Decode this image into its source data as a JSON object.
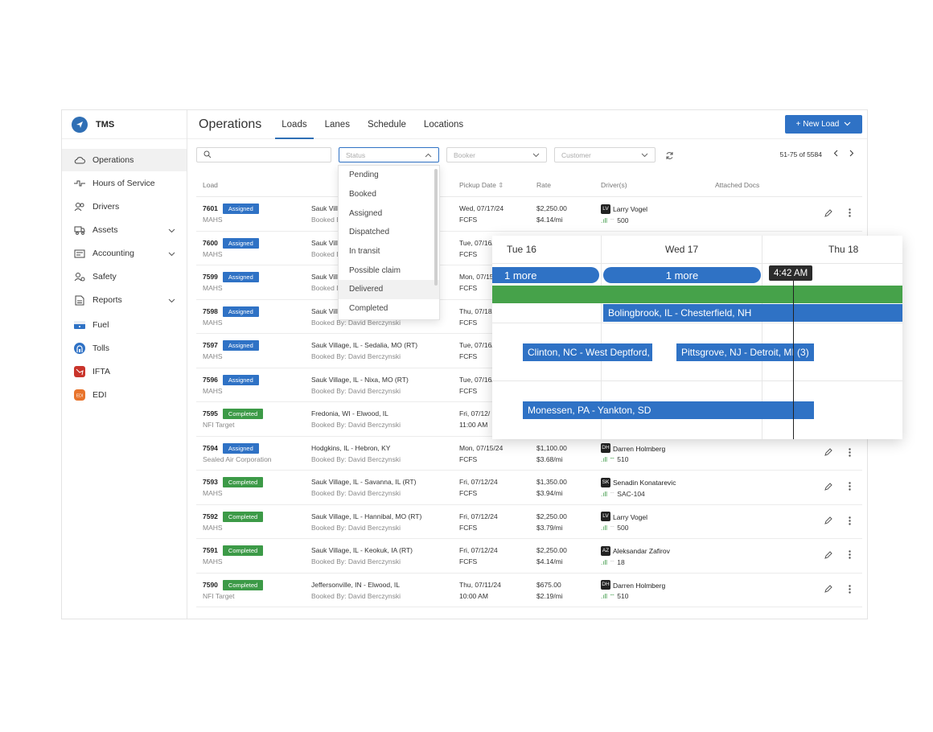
{
  "app": {
    "name": "TMS"
  },
  "sidebar": {
    "items": [
      {
        "label": "Operations",
        "icon": "cloud-icon",
        "active": true,
        "expandable": false
      },
      {
        "label": "Hours of Service",
        "icon": "pulse-icon",
        "active": false,
        "expandable": false
      },
      {
        "label": "Drivers",
        "icon": "users-icon",
        "active": false,
        "expandable": false
      },
      {
        "label": "Assets",
        "icon": "truck-icon",
        "active": false,
        "expandable": true
      },
      {
        "label": "Accounting",
        "icon": "ledger-icon",
        "active": false,
        "expandable": true
      },
      {
        "label": "Safety",
        "icon": "safety-icon",
        "active": false,
        "expandable": false
      },
      {
        "label": "Reports",
        "icon": "report-icon",
        "active": false,
        "expandable": true
      },
      {
        "label": "Fuel",
        "icon": "fuel-icon",
        "active": false,
        "expandable": false
      },
      {
        "label": "Tolls",
        "icon": "tolls-icon",
        "active": false,
        "expandable": false
      },
      {
        "label": "IFTA",
        "icon": "ifta-icon",
        "active": false,
        "expandable": false
      },
      {
        "label": "EDI",
        "icon": "edi-icon",
        "active": false,
        "expandable": false
      }
    ]
  },
  "header": {
    "title": "Operations",
    "tabs": [
      "Loads",
      "Lanes",
      "Schedule",
      "Locations"
    ],
    "active_tab": "Loads",
    "new_load_label": "+ New Load"
  },
  "filters": {
    "search_placeholder": "",
    "status_placeholder": "Status",
    "booker_placeholder": "Booker",
    "customer_placeholder": "Customer",
    "pagination": "51-75 of 5584"
  },
  "table": {
    "headers": [
      "Load",
      "Pickup Date",
      "Rate",
      "Driver(s)",
      "Attached Docs"
    ],
    "rows": [
      {
        "id": "7601",
        "status": "Assigned",
        "customer": "MAHS",
        "route": "Sauk Villa",
        "booked": "Booked B",
        "date": "Wed, 07/17/24",
        "time": "FCFS",
        "rate": "$2,250.00",
        "rpm": "$4.14/mi",
        "driver_init": "LV",
        "driver": "Larry Vogel",
        "truck": "500",
        "wifi": false
      },
      {
        "id": "7600",
        "status": "Assigned",
        "customer": "MAHS",
        "route": "Sauk Villa",
        "booked": "Booked B",
        "date": "Tue, 07/16/",
        "time": "FCFS",
        "rate": "",
        "rpm": "",
        "driver_init": "",
        "driver": "",
        "truck": "",
        "wifi": false
      },
      {
        "id": "7599",
        "status": "Assigned",
        "customer": "MAHS",
        "route": "Sauk Villa",
        "booked": "Booked B",
        "date": "Mon, 07/15/",
        "time": "FCFS",
        "rate": "",
        "rpm": "",
        "driver_init": "",
        "driver": "",
        "truck": "",
        "wifi": false
      },
      {
        "id": "7598",
        "status": "Assigned",
        "customer": "MAHS",
        "route": "Sauk Villa",
        "booked": "Booked By: David Berczynski",
        "date": "Thu, 07/18/",
        "time": "FCFS",
        "rate": "",
        "rpm": "",
        "driver_init": "",
        "driver": "",
        "truck": "",
        "wifi": false
      },
      {
        "id": "7597",
        "status": "Assigned",
        "customer": "MAHS",
        "route": "Sauk Village, IL - Sedalia, MO (RT)",
        "booked": "Booked By: David Berczynski",
        "date": "Tue, 07/16/",
        "time": "FCFS",
        "rate": "",
        "rpm": "",
        "driver_init": "",
        "driver": "",
        "truck": "",
        "wifi": false
      },
      {
        "id": "7596",
        "status": "Assigned",
        "customer": "MAHS",
        "route": "Sauk Village, IL - Nixa, MO (RT)",
        "booked": "Booked By: David Berczynski",
        "date": "Tue, 07/16/",
        "time": "FCFS",
        "rate": "",
        "rpm": "",
        "driver_init": "",
        "driver": "",
        "truck": "",
        "wifi": false
      },
      {
        "id": "7595",
        "status": "Completed",
        "customer": "NFI Target",
        "route": "Fredonia, WI - Elwood, IL",
        "booked": "Booked By: David Berczynski",
        "date": "Fri, 07/12/",
        "time": "11:00 AM",
        "rate": "",
        "rpm": "",
        "driver_init": "",
        "driver": "",
        "truck": "",
        "wifi": false
      },
      {
        "id": "7594",
        "status": "Assigned",
        "customer": "Sealed Air Corporation",
        "route": "Hodgkins, IL - Hebron, KY",
        "booked": "Booked By: David Berczynski",
        "date": "Mon, 07/15/24",
        "time": "FCFS",
        "rate": "$1,100.00",
        "rpm": "$3.68/mi",
        "driver_init": "DH",
        "driver": "Darren Holmberg",
        "truck": "510",
        "wifi": true
      },
      {
        "id": "7593",
        "status": "Completed",
        "customer": "MAHS",
        "route": "Sauk Village, IL - Savanna, IL (RT)",
        "booked": "Booked By: David Berczynski",
        "date": "Fri, 07/12/24",
        "time": "FCFS",
        "rate": "$1,350.00",
        "rpm": "$3.94/mi",
        "driver_init": "SK",
        "driver": "Senadin Konatarevic",
        "truck": "SAC-104",
        "wifi": false
      },
      {
        "id": "7592",
        "status": "Completed",
        "customer": "MAHS",
        "route": "Sauk Village, IL - Hannibal, MO (RT)",
        "booked": "Booked By: David Berczynski",
        "date": "Fri, 07/12/24",
        "time": "FCFS",
        "rate": "$2,250.00",
        "rpm": "$3.79/mi",
        "driver_init": "LV",
        "driver": "Larry Vogel",
        "truck": "500",
        "wifi": false
      },
      {
        "id": "7591",
        "status": "Completed",
        "customer": "MAHS",
        "route": "Sauk Village, IL - Keokuk, IA (RT)",
        "booked": "Booked By: David Berczynski",
        "date": "Fri, 07/12/24",
        "time": "FCFS",
        "rate": "$2,250.00",
        "rpm": "$4.14/mi",
        "driver_init": "AZ",
        "driver": "Aleksandar Zafirov",
        "truck": "18",
        "wifi": false
      },
      {
        "id": "7590",
        "status": "Completed",
        "customer": "NFI Target",
        "route": "Jeffersonville, IN - Elwood, IL",
        "booked": "Booked By: David Berczynski",
        "date": "Thu, 07/11/24",
        "time": "10:00 AM",
        "rate": "$675.00",
        "rpm": "$2.19/mi",
        "driver_init": "DH",
        "driver": "Darren Holmberg",
        "truck": "510",
        "wifi": true
      }
    ]
  },
  "status_dropdown": {
    "options": [
      "Pending",
      "Booked",
      "Assigned",
      "Dispatched",
      "In transit",
      "Possible claim",
      "Delivered",
      "Completed"
    ],
    "hovered": "Delivered"
  },
  "schedule": {
    "days": [
      "Tue 16",
      "Wed 17",
      "Thu 18"
    ],
    "more_1": "1 more",
    "more_2": "1 more",
    "now_label": "4:42 AM",
    "bars": {
      "bolingbrook": "Bolingbrook, IL - Chesterfield, NH",
      "clinton": "Clinton, NC - West Deptford,",
      "pittsgrove": "Pittsgrove, NJ - Detroit, MI (3)",
      "monessen": "Monessen, PA - Yankton, SD"
    }
  },
  "colors": {
    "accent": "#2f72c5",
    "completed": "#3c9a47",
    "green_bar": "#46a24a"
  }
}
